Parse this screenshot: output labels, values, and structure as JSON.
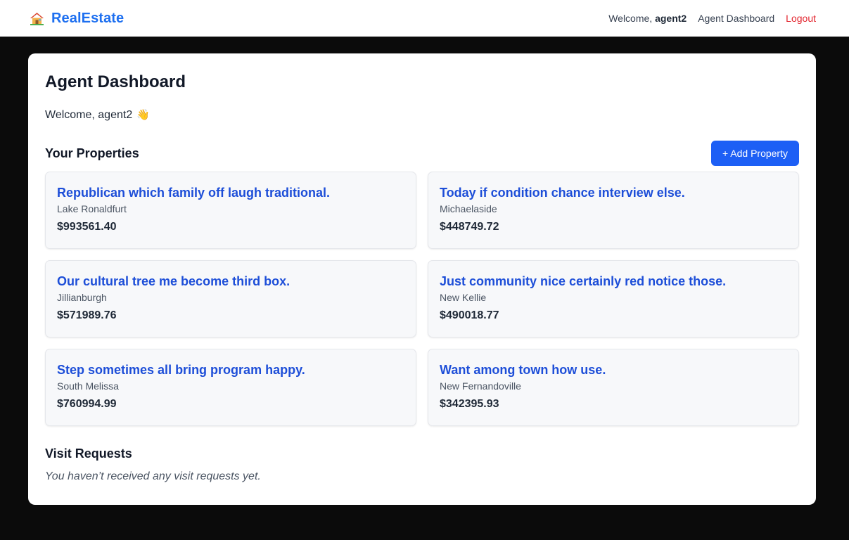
{
  "nav": {
    "brand": "RealEstate",
    "brand_icon": "house-icon",
    "welcome_prefix": "Welcome, ",
    "username": "agent2",
    "dashboard_link": "Agent Dashboard",
    "logout_link": "Logout"
  },
  "main": {
    "title": "Agent Dashboard",
    "welcome": "Welcome, agent2",
    "welcome_icon": "waving-hand-icon",
    "properties_heading": "Your Properties",
    "add_property_label": "+ Add Property",
    "properties": [
      {
        "title": "Republican which family off laugh traditional.",
        "city": "Lake Ronaldfurt",
        "price": "$993561.40"
      },
      {
        "title": "Today if condition chance interview else.",
        "city": "Michaelaside",
        "price": "$448749.72"
      },
      {
        "title": "Our cultural tree me become third box.",
        "city": "Jillianburgh",
        "price": "$571989.76"
      },
      {
        "title": "Just community nice certainly red notice those.",
        "city": "New Kellie",
        "price": "$490018.77"
      },
      {
        "title": "Step sometimes all bring program happy.",
        "city": "South Melissa",
        "price": "$760994.99"
      },
      {
        "title": "Want among town how use.",
        "city": "New Fernandoville",
        "price": "$342395.93"
      }
    ],
    "visit_heading": "Visit Requests",
    "visit_empty": "You haven’t received any visit requests yet."
  },
  "colors": {
    "brand": "#1d6ff0",
    "primary_button": "#1d5ff5",
    "property_title": "#1d4ed8",
    "logout": "#e3262f",
    "page_background": "#0b0b0b"
  }
}
